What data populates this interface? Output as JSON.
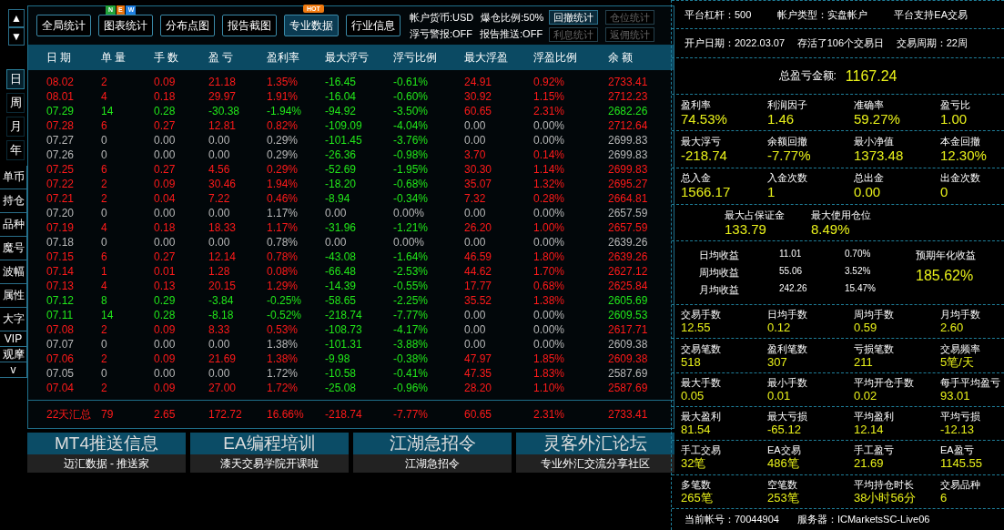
{
  "nav": {
    "up": "▲",
    "down": "▼"
  },
  "period_tabs": [
    {
      "label": "日",
      "selected": true
    },
    {
      "label": "周",
      "selected": false
    },
    {
      "label": "月",
      "selected": false
    },
    {
      "label": "年",
      "selected": false
    }
  ],
  "side_items": [
    "单币",
    "持仓",
    "品种",
    "魔号",
    "波幅",
    "属性",
    "大字",
    "VIP",
    "观摩",
    "v"
  ],
  "toolbar": [
    {
      "label": "全局统计",
      "selected": false
    },
    {
      "label": "图表统计",
      "selected": false,
      "badge": {
        "kind": "new",
        "text": "NEW"
      }
    },
    {
      "label": "分布点图",
      "selected": false
    },
    {
      "label": "报告截图",
      "selected": false
    },
    {
      "label": "专业数据",
      "selected": true,
      "badge": {
        "kind": "hot",
        "text": "HOT"
      }
    },
    {
      "label": "行业信息",
      "selected": false
    }
  ],
  "settings": [
    [
      "帐户货币:USD",
      "爆仓比例:50%"
    ],
    [
      "浮亏警报:OFF",
      "报告推送:OFF"
    ]
  ],
  "side_buttons": [
    {
      "label": "回撤统计",
      "selected": true,
      "disabled": false
    },
    {
      "label": "仓位统计",
      "selected": false,
      "disabled": true
    },
    {
      "label": "利息统计",
      "selected": false,
      "disabled": true
    },
    {
      "label": "返佣统计",
      "selected": false,
      "disabled": true
    }
  ],
  "columns": [
    "日 期",
    "单 量",
    "手 数",
    "盈 亏",
    "盈利率",
    "最大浮亏",
    "浮亏比例",
    "最大浮盈",
    "浮盈比例",
    "余 额"
  ],
  "rows": [
    {
      "date": "08.02",
      "orders": "2",
      "lots": "0.09",
      "pnl": "21.18",
      "rate": "1.35%",
      "color": "#ff1a1a",
      "drawdown": {
        "value": "-16.45",
        "ratio": "-0.61%",
        "color": "#22e81a"
      },
      "runup": {
        "value": "24.91",
        "ratio": "0.92%",
        "color": "#ff1a1a"
      },
      "balance": "2733.41"
    },
    {
      "date": "08.01",
      "orders": "4",
      "lots": "0.18",
      "pnl": "29.97",
      "rate": "1.91%",
      "color": "#ff1a1a",
      "drawdown": {
        "value": "-16.04",
        "ratio": "-0.60%",
        "color": "#22e81a"
      },
      "runup": {
        "value": "30.92",
        "ratio": "1.15%",
        "color": "#ff1a1a"
      },
      "balance": "2712.23"
    },
    {
      "date": "07.29",
      "orders": "14",
      "lots": "0.28",
      "pnl": "-30.38",
      "rate": "-1.94%",
      "color": "#22e81a",
      "drawdown": {
        "value": "-94.92",
        "ratio": "-3.50%",
        "color": "#22e81a"
      },
      "runup": {
        "value": "60.65",
        "ratio": "2.31%",
        "color": "#ff1a1a"
      },
      "balance": "2682.26"
    },
    {
      "date": "07.28",
      "orders": "6",
      "lots": "0.27",
      "pnl": "12.81",
      "rate": "0.82%",
      "color": "#ff1a1a",
      "drawdown": {
        "value": "-109.09",
        "ratio": "-4.04%",
        "color": "#22e81a"
      },
      "runup": {
        "value": "0.00",
        "ratio": "0.00%",
        "color": "#b8b8b8"
      },
      "balance": "2712.64"
    },
    {
      "date": "07.27",
      "orders": "0",
      "lots": "0.00",
      "pnl": "0.00",
      "rate": "0.29%",
      "color": "#b8b8b8",
      "drawdown": {
        "value": "-101.45",
        "ratio": "-3.76%",
        "color": "#22e81a"
      },
      "runup": {
        "value": "0.00",
        "ratio": "0.00%",
        "color": "#b8b8b8"
      },
      "balance": "2699.83"
    },
    {
      "date": "07.26",
      "orders": "0",
      "lots": "0.00",
      "pnl": "0.00",
      "rate": "0.29%",
      "color": "#b8b8b8",
      "drawdown": {
        "value": "-26.36",
        "ratio": "-0.98%",
        "color": "#22e81a"
      },
      "runup": {
        "value": "3.70",
        "ratio": "0.14%",
        "color": "#ff1a1a"
      },
      "balance": "2699.83"
    },
    {
      "date": "07.25",
      "orders": "6",
      "lots": "0.27",
      "pnl": "4.56",
      "rate": "0.29%",
      "color": "#ff1a1a",
      "drawdown": {
        "value": "-52.69",
        "ratio": "-1.95%",
        "color": "#22e81a"
      },
      "runup": {
        "value": "30.30",
        "ratio": "1.14%",
        "color": "#ff1a1a"
      },
      "balance": "2699.83"
    },
    {
      "date": "07.22",
      "orders": "2",
      "lots": "0.09",
      "pnl": "30.46",
      "rate": "1.94%",
      "color": "#ff1a1a",
      "drawdown": {
        "value": "-18.20",
        "ratio": "-0.68%",
        "color": "#22e81a"
      },
      "runup": {
        "value": "35.07",
        "ratio": "1.32%",
        "color": "#ff1a1a"
      },
      "balance": "2695.27"
    },
    {
      "date": "07.21",
      "orders": "2",
      "lots": "0.04",
      "pnl": "7.22",
      "rate": "0.46%",
      "color": "#ff1a1a",
      "drawdown": {
        "value": "-8.94",
        "ratio": "-0.34%",
        "color": "#22e81a"
      },
      "runup": {
        "value": "7.32",
        "ratio": "0.28%",
        "color": "#ff1a1a"
      },
      "balance": "2664.81"
    },
    {
      "date": "07.20",
      "orders": "0",
      "lots": "0.00",
      "pnl": "0.00",
      "rate": "1.17%",
      "color": "#b8b8b8",
      "drawdown": {
        "value": "0.00",
        "ratio": "0.00%",
        "color": "#b8b8b8"
      },
      "runup": {
        "value": "0.00",
        "ratio": "0.00%",
        "color": "#b8b8b8"
      },
      "balance": "2657.59"
    },
    {
      "date": "07.19",
      "orders": "4",
      "lots": "0.18",
      "pnl": "18.33",
      "rate": "1.17%",
      "color": "#ff1a1a",
      "drawdown": {
        "value": "-31.96",
        "ratio": "-1.21%",
        "color": "#22e81a"
      },
      "runup": {
        "value": "26.20",
        "ratio": "1.00%",
        "color": "#ff1a1a"
      },
      "balance": "2657.59"
    },
    {
      "date": "07.18",
      "orders": "0",
      "lots": "0.00",
      "pnl": "0.00",
      "rate": "0.78%",
      "color": "#b8b8b8",
      "drawdown": {
        "value": "0.00",
        "ratio": "0.00%",
        "color": "#b8b8b8"
      },
      "runup": {
        "value": "0.00",
        "ratio": "0.00%",
        "color": "#b8b8b8"
      },
      "balance": "2639.26"
    },
    {
      "date": "07.15",
      "orders": "6",
      "lots": "0.27",
      "pnl": "12.14",
      "rate": "0.78%",
      "color": "#ff1a1a",
      "drawdown": {
        "value": "-43.08",
        "ratio": "-1.64%",
        "color": "#22e81a"
      },
      "runup": {
        "value": "46.59",
        "ratio": "1.80%",
        "color": "#ff1a1a"
      },
      "balance": "2639.26"
    },
    {
      "date": "07.14",
      "orders": "1",
      "lots": "0.01",
      "pnl": "1.28",
      "rate": "0.08%",
      "color": "#ff1a1a",
      "drawdown": {
        "value": "-66.48",
        "ratio": "-2.53%",
        "color": "#22e81a"
      },
      "runup": {
        "value": "44.62",
        "ratio": "1.70%",
        "color": "#ff1a1a"
      },
      "balance": "2627.12"
    },
    {
      "date": "07.13",
      "orders": "4",
      "lots": "0.13",
      "pnl": "20.15",
      "rate": "1.29%",
      "color": "#ff1a1a",
      "drawdown": {
        "value": "-14.39",
        "ratio": "-0.55%",
        "color": "#22e81a"
      },
      "runup": {
        "value": "17.77",
        "ratio": "0.68%",
        "color": "#ff1a1a"
      },
      "balance": "2625.84"
    },
    {
      "date": "07.12",
      "orders": "8",
      "lots": "0.29",
      "pnl": "-3.84",
      "rate": "-0.25%",
      "color": "#22e81a",
      "drawdown": {
        "value": "-58.65",
        "ratio": "-2.25%",
        "color": "#22e81a"
      },
      "runup": {
        "value": "35.52",
        "ratio": "1.38%",
        "color": "#ff1a1a"
      },
      "balance": "2605.69"
    },
    {
      "date": "07.11",
      "orders": "14",
      "lots": "0.28",
      "pnl": "-8.18",
      "rate": "-0.52%",
      "color": "#22e81a",
      "drawdown": {
        "value": "-218.74",
        "ratio": "-7.77%",
        "color": "#22e81a"
      },
      "runup": {
        "value": "0.00",
        "ratio": "0.00%",
        "color": "#b8b8b8"
      },
      "balance": "2609.53"
    },
    {
      "date": "07.08",
      "orders": "2",
      "lots": "0.09",
      "pnl": "8.33",
      "rate": "0.53%",
      "color": "#ff1a1a",
      "drawdown": {
        "value": "-108.73",
        "ratio": "-4.17%",
        "color": "#22e81a"
      },
      "runup": {
        "value": "0.00",
        "ratio": "0.00%",
        "color": "#b8b8b8"
      },
      "balance": "2617.71"
    },
    {
      "date": "07.07",
      "orders": "0",
      "lots": "0.00",
      "pnl": "0.00",
      "rate": "1.38%",
      "color": "#b8b8b8",
      "drawdown": {
        "value": "-101.31",
        "ratio": "-3.88%",
        "color": "#22e81a"
      },
      "runup": {
        "value": "0.00",
        "ratio": "0.00%",
        "color": "#b8b8b8"
      },
      "balance": "2609.38"
    },
    {
      "date": "07.06",
      "orders": "2",
      "lots": "0.09",
      "pnl": "21.69",
      "rate": "1.38%",
      "color": "#ff1a1a",
      "drawdown": {
        "value": "-9.98",
        "ratio": "-0.38%",
        "color": "#22e81a"
      },
      "runup": {
        "value": "47.97",
        "ratio": "1.85%",
        "color": "#ff1a1a"
      },
      "balance": "2609.38"
    },
    {
      "date": "07.05",
      "orders": "0",
      "lots": "0.00",
      "pnl": "0.00",
      "rate": "1.72%",
      "color": "#b8b8b8",
      "drawdown": {
        "value": "-10.58",
        "ratio": "-0.41%",
        "color": "#22e81a"
      },
      "runup": {
        "value": "47.35",
        "ratio": "1.83%",
        "color": "#ff1a1a"
      },
      "balance": "2587.69"
    },
    {
      "date": "07.04",
      "orders": "2",
      "lots": "0.09",
      "pnl": "27.00",
      "rate": "1.72%",
      "color": "#ff1a1a",
      "drawdown": {
        "value": "-25.08",
        "ratio": "-0.96%",
        "color": "#22e81a"
      },
      "runup": {
        "value": "28.20",
        "ratio": "1.10%",
        "color": "#ff1a1a"
      },
      "balance": "2587.69"
    }
  ],
  "summary": [
    "22天汇总",
    "79",
    "2.65",
    "172.72",
    "16.66%",
    "-218.74",
    "-7.77%",
    "60.65",
    "2.31%",
    "2733.41"
  ],
  "banners": [
    {
      "title": "MT4推送信息",
      "subtitle": "迈汇数据 - 推送家"
    },
    {
      "title": "EA编程培训",
      "subtitle": "漆天交易学院开课啦"
    },
    {
      "title": "江湖急招令",
      "subtitle": "江湖急招令"
    },
    {
      "title": "灵客外汇论坛",
      "subtitle": "专业外汇交流分享社区"
    }
  ],
  "info_rows": [
    [
      "平台杠杆：500",
      "帐户类型：实盘帐户",
      "平台支持EA交易"
    ],
    [
      "开户日期：2022.03.07",
      "存活了106个交易日",
      "交易周期：22周"
    ]
  ],
  "total": {
    "label": "总盈亏金额:",
    "value": "1167.24"
  },
  "stats_a": [
    [
      {
        "label": "盈利率",
        "value": "74.53%"
      },
      {
        "label": "利润因子",
        "value": "1.46"
      },
      {
        "label": "准确率",
        "value": "59.27%"
      },
      {
        "label": "盈亏比",
        "value": "1.00"
      }
    ],
    [
      {
        "label": "最大浮亏",
        "value": "-218.74"
      },
      {
        "label": "余额回撤",
        "value": "-7.77%"
      },
      {
        "label": "最小净值",
        "value": "1373.48"
      },
      {
        "label": "本金回撤",
        "value": "12.30%"
      }
    ],
    [
      {
        "label": "总入金",
        "value": "1566.17"
      },
      {
        "label": "入金次数",
        "value": "1"
      },
      {
        "label": "总出金",
        "value": "0.00"
      },
      {
        "label": "出金次数",
        "value": "0"
      }
    ]
  ],
  "margin": [
    {
      "label": "最大占保证金",
      "value": "133.79"
    },
    {
      "label": "最大使用仓位",
      "value": "8.49%"
    }
  ],
  "averages": {
    "rows": [
      {
        "label": "日均收益",
        "amount": "11.01",
        "percent": "0.70%"
      },
      {
        "label": "周均收益",
        "amount": "55.06",
        "percent": "3.52%"
      },
      {
        "label": "月均收益",
        "amount": "242.26",
        "percent": "15.47%"
      }
    ],
    "annual_label": "预期年化收益",
    "annual_value": "185.62%"
  },
  "stats_b": [
    [
      {
        "label": "交易手数",
        "value": "12.55"
      },
      {
        "label": "日均手数",
        "value": "0.12"
      },
      {
        "label": "周均手数",
        "value": "0.59"
      },
      {
        "label": "月均手数",
        "value": "2.60"
      }
    ],
    [
      {
        "label": "交易笔数",
        "value": "518"
      },
      {
        "label": "盈利笔数",
        "value": "307"
      },
      {
        "label": "亏损笔数",
        "value": "211"
      },
      {
        "label": "交易频率",
        "value": "5笔/天"
      }
    ],
    [
      {
        "label": "最大手数",
        "value": "0.05"
      },
      {
        "label": "最小手数",
        "value": "0.01"
      },
      {
        "label": "平均开仓手数",
        "value": "0.02"
      },
      {
        "label": "每手平均盈亏",
        "value": "93.01"
      }
    ],
    [
      {
        "label": "最大盈利",
        "value": "81.54"
      },
      {
        "label": "最大亏损",
        "value": "-65.12"
      },
      {
        "label": "平均盈利",
        "value": "12.14"
      },
      {
        "label": "平均亏损",
        "value": "-12.13"
      }
    ],
    [
      {
        "label": "手工交易",
        "value": "32笔"
      },
      {
        "label": "EA交易",
        "value": "486笔"
      },
      {
        "label": "手工盈亏",
        "value": "21.69"
      },
      {
        "label": "EA盈亏",
        "value": "1145.55"
      }
    ],
    [
      {
        "label": "多笔数",
        "value": "265笔"
      },
      {
        "label": "空笔数",
        "value": "253笔"
      },
      {
        "label": "平均持仓时长",
        "value": "38小时56分"
      },
      {
        "label": "交易品种",
        "value": "6"
      }
    ]
  ],
  "footer": [
    "当前帐号：70044904",
    "服务器：ICMarketsSC-Live06"
  ]
}
